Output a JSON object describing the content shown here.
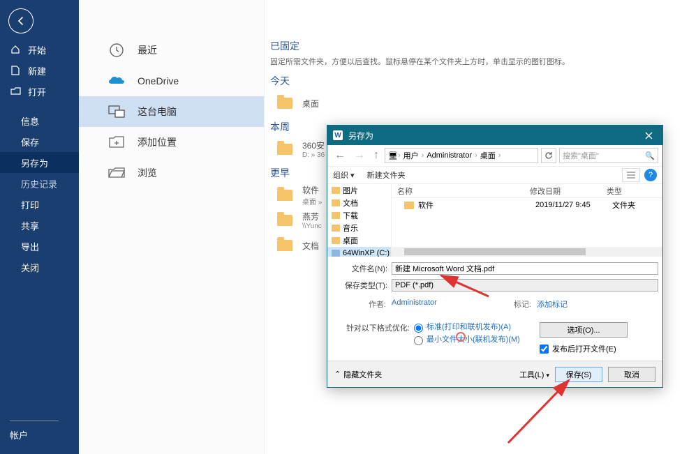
{
  "page_title": "另存为",
  "sidebar": {
    "items": [
      {
        "id": "home",
        "label": "开始",
        "icon": "home"
      },
      {
        "id": "new",
        "label": "新建",
        "icon": "file"
      },
      {
        "id": "open",
        "label": "打开",
        "icon": "folder"
      },
      {
        "id": "info",
        "label": "信息"
      },
      {
        "id": "save",
        "label": "保存"
      },
      {
        "id": "saveas",
        "label": "另存为",
        "selected": true
      },
      {
        "id": "history",
        "label": "历史记录",
        "muted": true
      },
      {
        "id": "print",
        "label": "打印"
      },
      {
        "id": "share",
        "label": "共享"
      },
      {
        "id": "export",
        "label": "导出"
      },
      {
        "id": "close",
        "label": "关闭"
      }
    ],
    "account": "帐户"
  },
  "locations": {
    "recent": "最近",
    "onedrive": "OneDrive",
    "thispc": "这台电脑",
    "addplace": "添加位置",
    "browse": "浏览"
  },
  "right": {
    "pinned_title": "已固定",
    "pinned_sub": "固定所需文件夹，方便以后查找。鼠标悬停在某个文件夹上方时，单击显示的图钉图标。",
    "today": "今天",
    "today_items": [
      {
        "label": "桌面"
      }
    ],
    "week": "本周",
    "week_items": [
      {
        "label": "360安",
        "sub": "D: » 36"
      }
    ],
    "older": "更早",
    "older_items": [
      {
        "label": "软件",
        "sub": "桌面 »"
      },
      {
        "label": "燕芳",
        "sub": "\\\\Yunc"
      },
      {
        "label": "文档"
      }
    ]
  },
  "dialog": {
    "title": "另存为",
    "breadcrumb": [
      "用户",
      "Administrator",
      "桌面"
    ],
    "search_placeholder": "搜索\"桌面\"",
    "organize": "组织",
    "new_folder": "新建文件夹",
    "tree": [
      "图片",
      "文档",
      "下载",
      "音乐",
      "桌面",
      "64WinXP  (C:)"
    ],
    "columns": {
      "name": "名称",
      "date": "修改日期",
      "type": "类型"
    },
    "rows": [
      {
        "name": "软件",
        "date": "2019/11/27 9:45",
        "type": "文件夹"
      }
    ],
    "filename_label": "文件名(N):",
    "filename_value": "新建 Microsoft Word 文档.pdf",
    "type_label": "保存类型(T):",
    "type_value": "PDF (*.pdf)",
    "author_label": "作者:",
    "author_value": "Administrator",
    "tag_label": "标记:",
    "tag_value": "添加标记",
    "optimize_label": "针对以下格式优化:",
    "radio_std": "标准(打印和联机发布)(A)",
    "radio_min": "最小文件大小(联机发布)(M)",
    "options_btn": "选项(O)...",
    "open_after": "发布后打开文件(E)",
    "hide_folders": "隐藏文件夹",
    "tools": "工具(L)",
    "save_btn": "保存(S)",
    "cancel_btn": "取消"
  }
}
